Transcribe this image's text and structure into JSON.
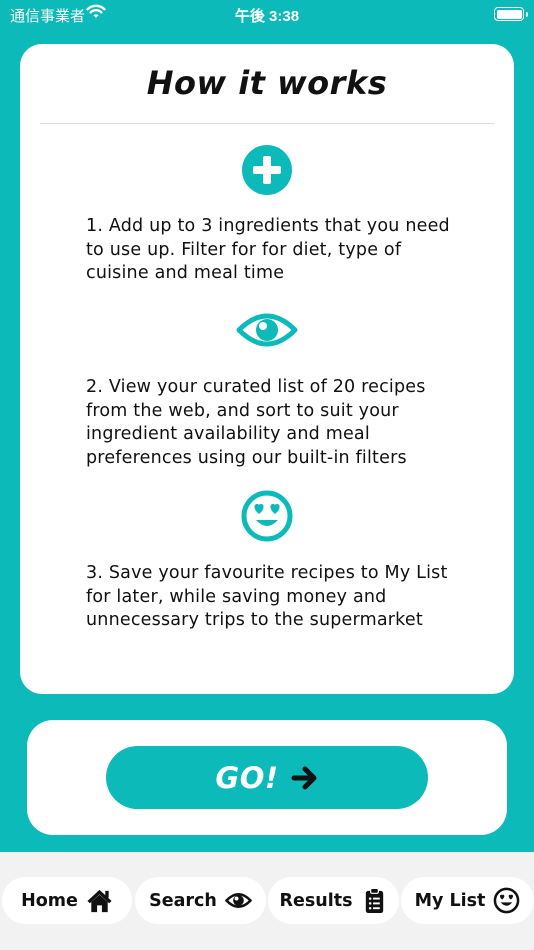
{
  "status_bar": {
    "carrier": "通信事業者",
    "time": "午後 3:38"
  },
  "card": {
    "title": "How it works",
    "steps": [
      {
        "icon": "plus-circle-icon",
        "text": "1. Add up to 3 ingredients that you need to use up. Filter for for diet, type of cuisine and meal time"
      },
      {
        "icon": "eye-icon",
        "text": "2. View your curated list of 20 recipes from the web, and sort to suit your ingredient availability and meal preferences using our built-in filters"
      },
      {
        "icon": "heart-eyes-smiley-icon",
        "text": "3. Save your favourite recipes to My List for later, while saving money and unnecessary trips to the supermarket"
      }
    ]
  },
  "go_button": {
    "label": "GO!",
    "icon": "arrow-right-icon"
  },
  "tab_bar": {
    "tabs": [
      {
        "label": "Home",
        "icon": "home-icon"
      },
      {
        "label": "Search",
        "icon": "eye-icon"
      },
      {
        "label": "Results",
        "icon": "clipboard-list-icon"
      },
      {
        "label": "My List",
        "icon": "heart-eyes-smiley-icon"
      }
    ]
  },
  "colors": {
    "accent": "#0bbab9",
    "card": "#ffffff",
    "tab_bar_bg": "#f2f2f2",
    "text": "#111111"
  }
}
